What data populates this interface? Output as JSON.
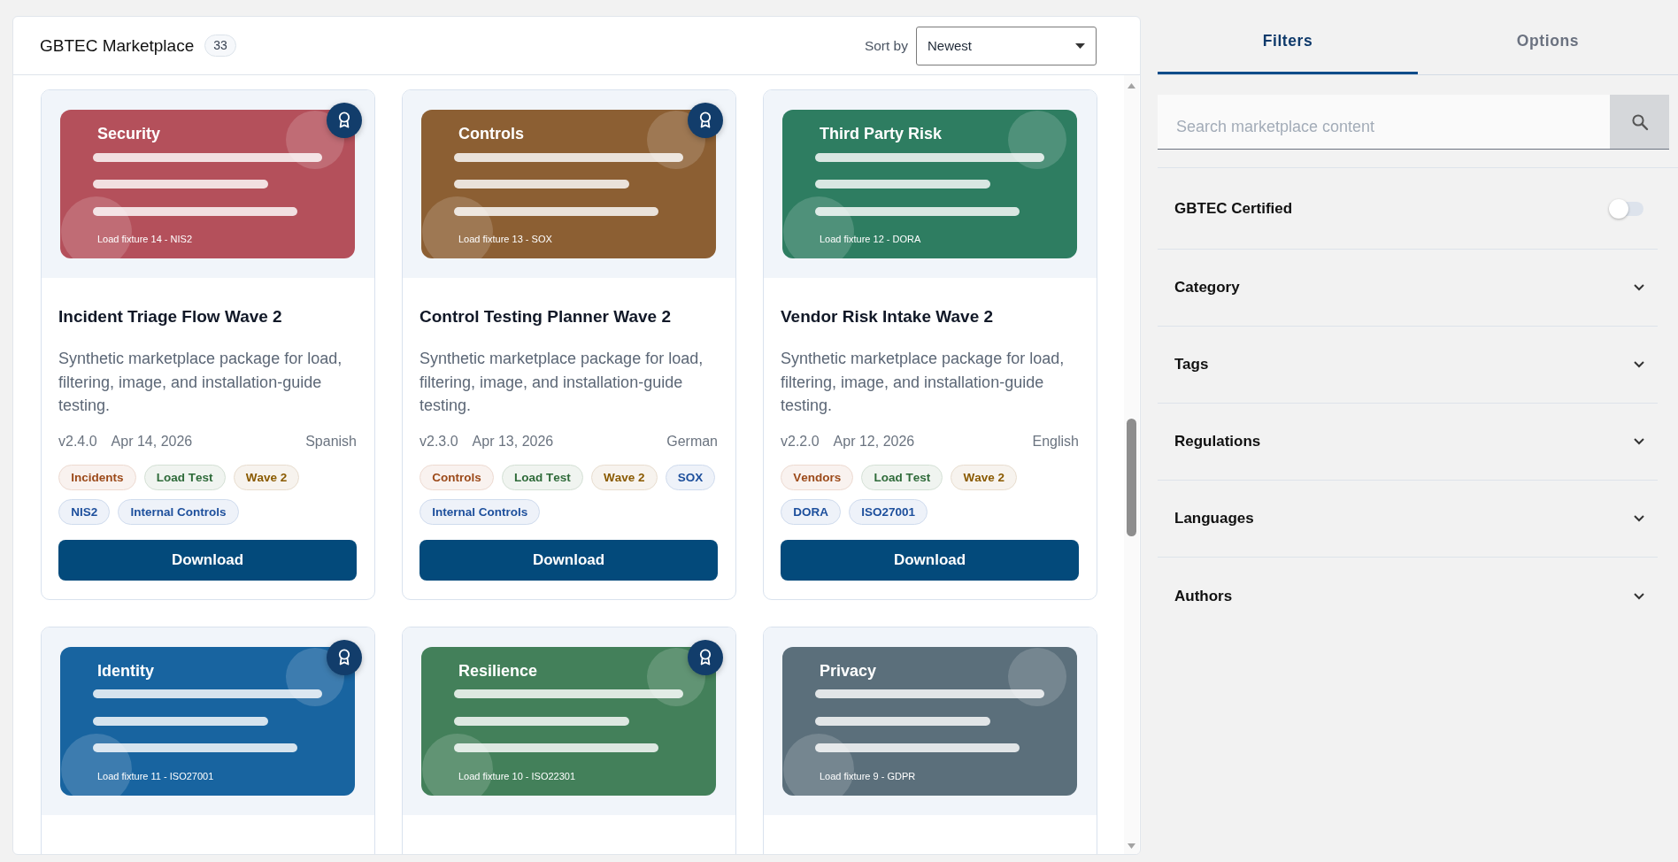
{
  "header": {
    "title": "GBTEC Marketplace",
    "count": "33",
    "sort_label": "Sort by",
    "sort_value": "Newest"
  },
  "cards": [
    {
      "thumbnail": {
        "title": "Security",
        "caption": "Load fixture 14 - NIS2",
        "color": "#b4505b"
      },
      "certified": true,
      "title": "Incident Triage Flow Wave 2",
      "description": "Synthetic marketplace package for load, filtering, image, and installation-guide testing.",
      "version": "v2.4.0",
      "date": "Apr 14, 2026",
      "language": "Spanish",
      "tags": [
        {
          "label": "Incidents",
          "color": "#9c4a1a"
        },
        {
          "label": "Load Test",
          "color": "#2f6b3a"
        },
        {
          "label": "Wave 2",
          "color": "#8a5a00"
        },
        {
          "label": "NIS2",
          "color": "#1d4f9c"
        },
        {
          "label": "Internal Controls",
          "color": "#1d4f9c"
        }
      ],
      "button": "Download"
    },
    {
      "thumbnail": {
        "title": "Controls",
        "caption": "Load fixture 13 - SOX",
        "color": "#8c5f33"
      },
      "certified": true,
      "title": "Control Testing Planner Wave 2",
      "description": "Synthetic marketplace package for load, filtering, image, and installation-guide testing.",
      "version": "v2.3.0",
      "date": "Apr 13, 2026",
      "language": "German",
      "tags": [
        {
          "label": "Controls",
          "color": "#9c4a1a"
        },
        {
          "label": "Load Test",
          "color": "#2f6b3a"
        },
        {
          "label": "Wave 2",
          "color": "#8a5a00"
        },
        {
          "label": "SOX",
          "color": "#1d4f9c"
        },
        {
          "label": "Internal Controls",
          "color": "#1d4f9c"
        }
      ],
      "button": "Download"
    },
    {
      "thumbnail": {
        "title": "Third Party Risk",
        "caption": "Load fixture 12 - DORA",
        "color": "#2e7d61"
      },
      "certified": false,
      "title": "Vendor Risk Intake Wave 2",
      "description": "Synthetic marketplace package for load, filtering, image, and installation-guide testing.",
      "version": "v2.2.0",
      "date": "Apr 12, 2026",
      "language": "English",
      "tags": [
        {
          "label": "Vendors",
          "color": "#9c4a1a"
        },
        {
          "label": "Load Test",
          "color": "#2f6b3a"
        },
        {
          "label": "Wave 2",
          "color": "#8a5a00"
        },
        {
          "label": "DORA",
          "color": "#1d4f9c"
        },
        {
          "label": "ISO27001",
          "color": "#1d4f9c"
        }
      ],
      "button": "Download"
    },
    {
      "thumbnail": {
        "title": "Identity",
        "caption": "Load fixture 11 - ISO27001",
        "color": "#1864a0"
      },
      "certified": true
    },
    {
      "thumbnail": {
        "title": "Resilience",
        "caption": "Load fixture 10 - ISO22301",
        "color": "#43805a"
      },
      "certified": true
    },
    {
      "thumbnail": {
        "title": "Privacy",
        "caption": "Load fixture 9 - GDPR",
        "color": "#5b6f7b"
      },
      "certified": false
    }
  ],
  "sidebar": {
    "tabs": [
      {
        "label": "Filters",
        "selected": true
      },
      {
        "label": "Options",
        "selected": false
      }
    ],
    "search": {
      "placeholder": "Search marketplace content"
    },
    "filters": [
      {
        "kind": "toggle",
        "label": "GBTEC Certified",
        "on": false
      },
      {
        "kind": "accordion",
        "label": "Category",
        "expanded": false
      },
      {
        "kind": "accordion",
        "label": "Tags",
        "expanded": false
      },
      {
        "kind": "accordion",
        "label": "Regulations",
        "expanded": false
      },
      {
        "kind": "accordion",
        "label": "Languages",
        "expanded": false
      },
      {
        "kind": "accordion",
        "label": "Authors",
        "expanded": false
      }
    ]
  }
}
